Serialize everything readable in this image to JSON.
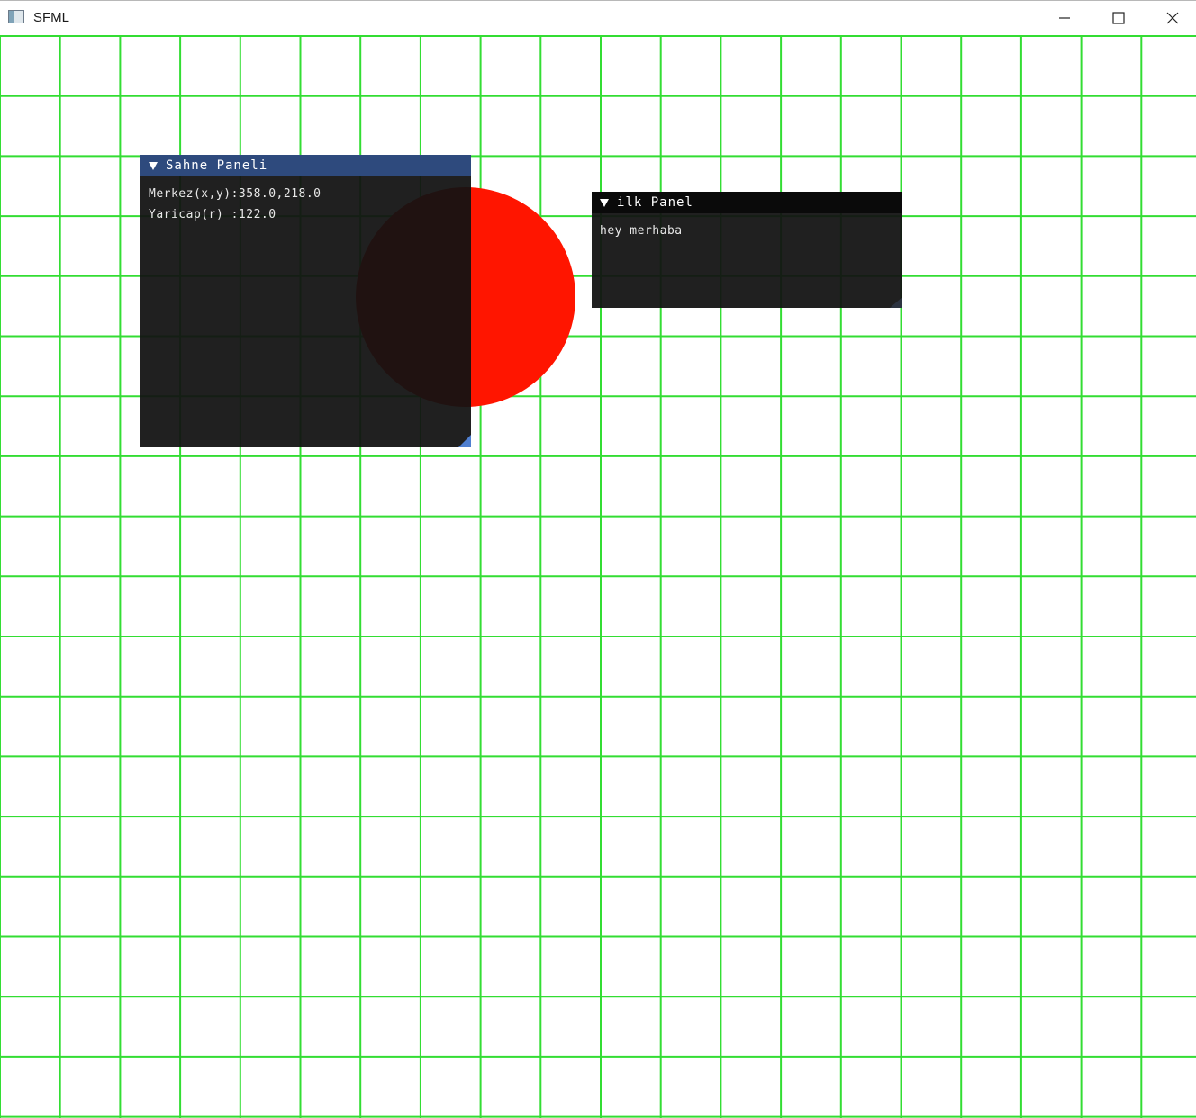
{
  "window": {
    "title": "SFML",
    "icons": {
      "app": "window-app-icon",
      "minimize": "minimize-icon",
      "maximize": "maximize-icon",
      "close": "close-icon"
    }
  },
  "scene": {
    "grid_color": "#33dd33",
    "circle_color": "#ff1500",
    "background": "#ffffff"
  },
  "sahne_panel": {
    "title": "Sahne Paneli",
    "center_line": "Merkez(x,y):358.0,218.0",
    "radius_line": "Yaricap(r) :122.0",
    "header_color": "#2e4a7d"
  },
  "ilk_panel": {
    "title": "ilk Panel",
    "text": "hey merhaba",
    "header_color": "#0a0a0a"
  }
}
